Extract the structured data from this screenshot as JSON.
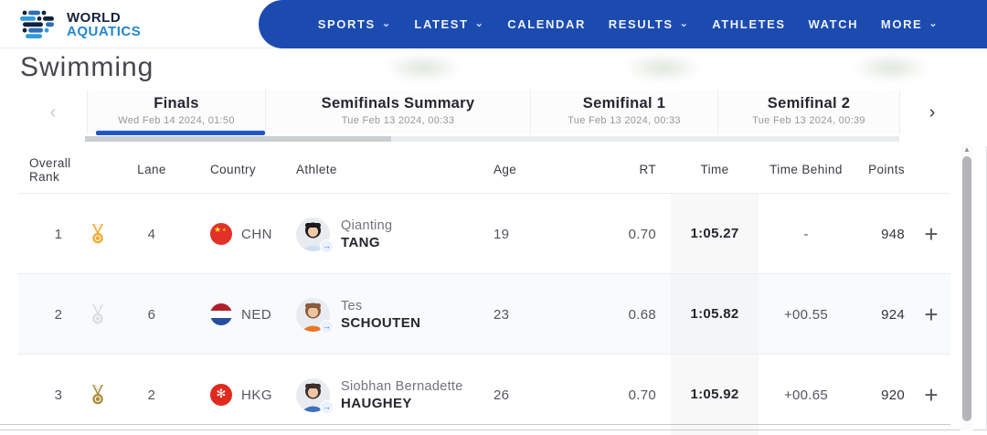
{
  "brand": {
    "line1": "WORLD",
    "line2": "AQUATICS"
  },
  "icons": {
    "chevron_down": "⌄",
    "chevron_left": "‹",
    "chevron_right": "›",
    "scroll_up_arrow": "▲",
    "expand_plus": "+",
    "profile_arrow": "→"
  },
  "colors": {
    "nav_blue": "#1c4bb0",
    "active_tab_blue": "#2157c4",
    "logo_blue": "#2286c9",
    "gold": "#f5a92f",
    "silver": "#d9dce0",
    "bronze": "#ab8c3c"
  },
  "nav": {
    "items": [
      {
        "label": "SPORTS"
      },
      {
        "label": "LATEST"
      },
      {
        "label": "CALENDAR"
      },
      {
        "label": "RESULTS"
      },
      {
        "label": "ATHLETES"
      },
      {
        "label": "WATCH"
      },
      {
        "label": "MORE"
      }
    ]
  },
  "page": {
    "title": "Swimming"
  },
  "tabs": [
    {
      "label": "Finals",
      "date": "Wed Feb 14 2024, 01:50",
      "active": true
    },
    {
      "label": "Semifinals Summary",
      "date": "Tue Feb 13 2024, 00:33",
      "active": false
    },
    {
      "label": "Semifinal 1",
      "date": "Tue Feb 13 2024, 00:33",
      "active": false
    },
    {
      "label": "Semifinal 2",
      "date": "Tue Feb 13 2024, 00:39",
      "active": false
    }
  ],
  "table": {
    "columns": {
      "rank": "Overall Rank",
      "lane": "Lane",
      "country": "Country",
      "athlete": "Athlete",
      "age": "Age",
      "rt": "RT",
      "time": "Time",
      "behind": "Time Behind",
      "points": "Points"
    },
    "rows": [
      {
        "rank": "1",
        "medal": "gold",
        "lane": "4",
        "country": "CHN",
        "first_name": "Qianting",
        "last_name": "TANG",
        "age": "19",
        "rt": "0.70",
        "time": "1:05.27",
        "behind": "-",
        "points": "948"
      },
      {
        "rank": "2",
        "medal": "silver",
        "lane": "6",
        "country": "NED",
        "first_name": "Tes",
        "last_name": "SCHOUTEN",
        "age": "23",
        "rt": "0.68",
        "time": "1:05.82",
        "behind": "+00.55",
        "points": "924"
      },
      {
        "rank": "3",
        "medal": "bronze",
        "lane": "2",
        "country": "HKG",
        "first_name": "Siobhan Bernadette",
        "last_name": "HAUGHEY",
        "age": "26",
        "rt": "0.70",
        "time": "1:05.92",
        "behind": "+00.65",
        "points": "920"
      }
    ]
  }
}
